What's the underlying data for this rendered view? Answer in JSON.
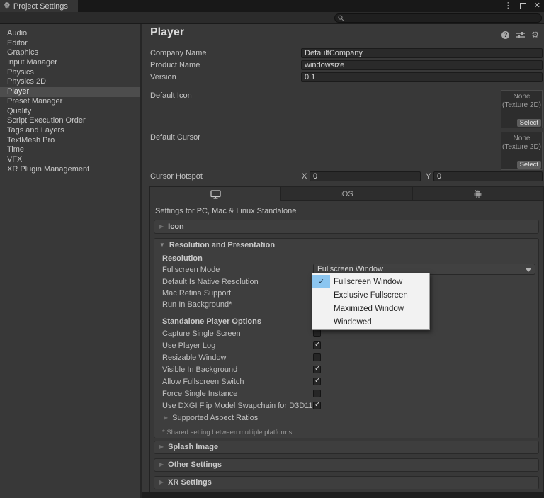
{
  "window": {
    "tab_title": "Project Settings"
  },
  "search": {
    "placeholder": ""
  },
  "sidebar": {
    "items": [
      "Audio",
      "Editor",
      "Graphics",
      "Input Manager",
      "Physics",
      "Physics 2D",
      "Player",
      "Preset Manager",
      "Quality",
      "Script Execution Order",
      "Tags and Layers",
      "TextMesh Pro",
      "Time",
      "VFX",
      "XR Plugin Management"
    ],
    "selected": "Player"
  },
  "header": {
    "title": "Player"
  },
  "fields": {
    "company_name": {
      "label": "Company Name",
      "value": "DefaultCompany"
    },
    "product_name": {
      "label": "Product Name",
      "value": "windowsize"
    },
    "version": {
      "label": "Version",
      "value": "0.1"
    },
    "default_icon": {
      "label": "Default Icon",
      "box_line1": "None",
      "box_line2": "(Texture 2D)",
      "select_label": "Select"
    },
    "default_cursor": {
      "label": "Default Cursor",
      "box_line1": "None",
      "box_line2": "(Texture 2D)",
      "select_label": "Select"
    },
    "cursor_hotspot": {
      "label": "Cursor Hotspot",
      "x_label": "X",
      "x_value": "0",
      "y_label": "Y",
      "y_value": "0"
    }
  },
  "platform_tabs": {
    "ios_label": "iOS"
  },
  "platform_heading": "Settings for PC, Mac & Linux Standalone",
  "sections": {
    "icon": "Icon",
    "resolution_presentation": "Resolution and Presentation",
    "splash": "Splash Image",
    "other": "Other Settings",
    "xr": "XR Settings"
  },
  "resolution": {
    "subheader": "Resolution",
    "fullscreen_mode": {
      "label": "Fullscreen Mode",
      "value": "Fullscreen Window"
    },
    "plain_rows": [
      {
        "label": "Default Is Native Resolution"
      },
      {
        "label": "Mac Retina Support"
      },
      {
        "label": "Run In Background*"
      }
    ],
    "standalone_header": "Standalone Player Options",
    "checkboxes": [
      {
        "label": "Capture Single Screen",
        "checked": false
      },
      {
        "label": "Use Player Log",
        "checked": true
      },
      {
        "label": "Resizable Window",
        "checked": false
      },
      {
        "label": "Visible In Background",
        "checked": true
      },
      {
        "label": "Allow Fullscreen Switch",
        "checked": true
      },
      {
        "label": "Force Single Instance",
        "checked": false
      },
      {
        "label": "Use DXGI Flip Model Swapchain for D3D11",
        "checked": true
      }
    ],
    "aspect_foldout": "Supported Aspect Ratios",
    "footnote": "* Shared setting between multiple platforms."
  },
  "dropdown_menu": {
    "items": [
      {
        "label": "Fullscreen Window",
        "selected": true
      },
      {
        "label": "Exclusive Fullscreen",
        "selected": false
      },
      {
        "label": "Maximized Window",
        "selected": false
      },
      {
        "label": "Windowed",
        "selected": false
      }
    ]
  },
  "colors": {
    "menu_check_blue": "#8cc6f0",
    "sidebar_selection": "#4d4d4d",
    "panel_bg": "#383838"
  }
}
